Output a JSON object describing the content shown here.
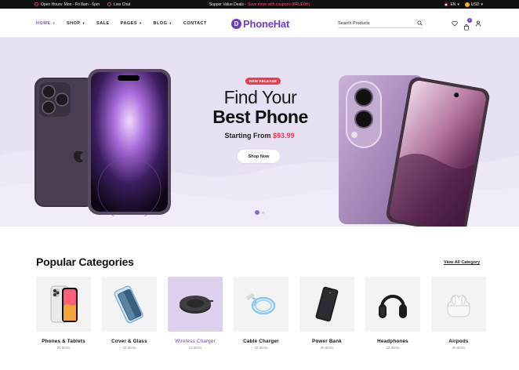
{
  "topbar": {
    "hours": "Open Hours: Mon - Fri 8am - 6pm",
    "live_chat": "Live Chat",
    "promo_prefix": "Supper Value Deals - ",
    "promo_highlight": "Save more with coupons (8RUE0H)",
    "language": "EN",
    "currency": "USD"
  },
  "nav": {
    "menu": [
      {
        "label": "HOME",
        "caret": true,
        "active": true
      },
      {
        "label": "SHOP",
        "caret": true
      },
      {
        "label": "SALE",
        "caret": false
      },
      {
        "label": "PAGES",
        "caret": true
      },
      {
        "label": "BLOG",
        "caret": true
      },
      {
        "label": "CONTACT",
        "caret": false
      }
    ],
    "logo_mark": "D",
    "logo_text": "PhoneHat",
    "search_placeholder": "Search Products",
    "cart_count": "2",
    "icons": [
      "heart-icon",
      "cart-icon",
      "user-icon",
      "search-icon"
    ]
  },
  "hero": {
    "badge": "NEW RELEASE",
    "title_line1": "Find Your",
    "title_line2": "Best Phone",
    "starting_label": "Starting From ",
    "price": "$93.99",
    "cta": "Shop Now",
    "colors": {
      "bg": "#e8e0f3",
      "accent": "#ef3b4f"
    }
  },
  "categories": {
    "title": "Popular Categories",
    "view_all": "View All Category",
    "items": [
      {
        "name": "Phones & Tablets",
        "count": "30 Items",
        "icon": "phone-icon"
      },
      {
        "name": "Cover & Glass",
        "count": "25 Items",
        "icon": "glass-cover-icon"
      },
      {
        "name": "Wireless Charger",
        "count": "13 Items",
        "icon": "wireless-charger-icon",
        "selected": true
      },
      {
        "name": "Cable Charger",
        "count": "25 Items",
        "icon": "cable-icon"
      },
      {
        "name": "Power Bank",
        "count": "25 Items",
        "icon": "power-bank-icon"
      },
      {
        "name": "Headphones",
        "count": "13 Items",
        "icon": "headphones-icon"
      },
      {
        "name": "Airpods",
        "count": "25 Items",
        "icon": "airpods-icon"
      }
    ]
  },
  "brand_color": "#6f3dc1"
}
